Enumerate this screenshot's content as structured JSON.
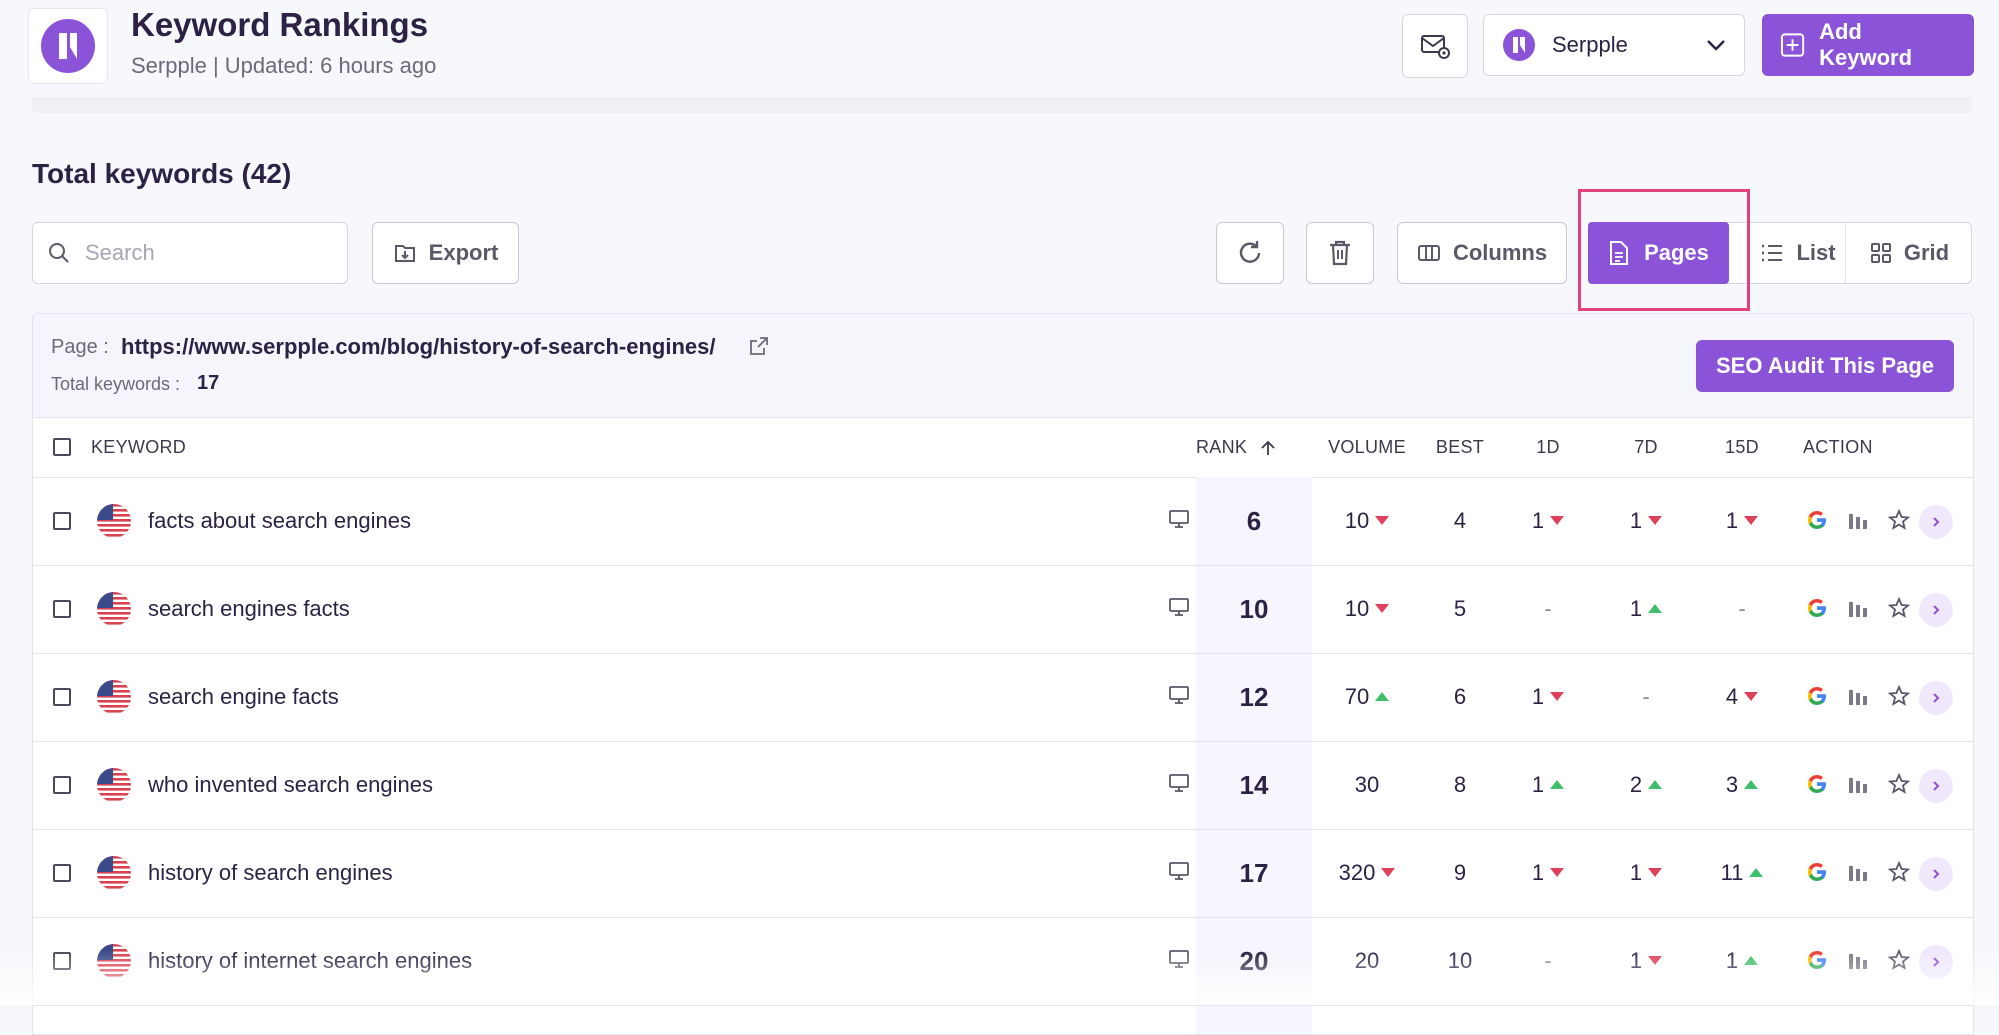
{
  "header": {
    "title": "Keyword Rankings",
    "subtitle": "Serpple | Updated: 6 hours ago",
    "project_select": "Serpple",
    "add_keyword_label": "Add Keyword"
  },
  "toolbar": {
    "total_keywords": "Total keywords (42)",
    "search_placeholder": "Search",
    "export_label": "Export",
    "columns_label": "Columns",
    "views": {
      "pages": "Pages",
      "list": "List",
      "grid": "Grid"
    },
    "active_view": "Pages"
  },
  "page_card": {
    "page_label": "Page :",
    "page_url": "https://www.serpple.com/blog/history-of-search-engines/",
    "total_label": "Total keywords :",
    "total_value": "17",
    "audit_label": "SEO Audit This Page"
  },
  "table": {
    "columns": {
      "keyword": "KEYWORD",
      "rank": "RANK",
      "volume": "VOLUME",
      "best": "BEST",
      "d1": "1D",
      "d7": "7D",
      "d15": "15D",
      "action": "ACTION"
    },
    "rows": [
      {
        "keyword": "facts about search engines",
        "rank": "6",
        "volume": "10",
        "volume_trend": "down",
        "best": "4",
        "d1": "1",
        "d1_trend": "down",
        "d7": "1",
        "d7_trend": "down",
        "d15": "1",
        "d15_trend": "down"
      },
      {
        "keyword": "search engines facts",
        "rank": "10",
        "volume": "10",
        "volume_trend": "down",
        "best": "5",
        "d1": "-",
        "d1_trend": "",
        "d7": "1",
        "d7_trend": "up",
        "d15": "-",
        "d15_trend": ""
      },
      {
        "keyword": "search engine facts",
        "rank": "12",
        "volume": "70",
        "volume_trend": "up",
        "best": "6",
        "d1": "1",
        "d1_trend": "down",
        "d7": "-",
        "d7_trend": "",
        "d15": "4",
        "d15_trend": "down"
      },
      {
        "keyword": "who invented search engines",
        "rank": "14",
        "volume": "30",
        "volume_trend": "",
        "best": "8",
        "d1": "1",
        "d1_trend": "up",
        "d7": "2",
        "d7_trend": "up",
        "d15": "3",
        "d15_trend": "up"
      },
      {
        "keyword": "history of search engines",
        "rank": "17",
        "volume": "320",
        "volume_trend": "down",
        "best": "9",
        "d1": "1",
        "d1_trend": "down",
        "d7": "1",
        "d7_trend": "down",
        "d15": "11",
        "d15_trend": "up"
      },
      {
        "keyword": "history of internet search engines",
        "rank": "20",
        "volume": "20",
        "volume_trend": "",
        "best": "10",
        "d1": "-",
        "d1_trend": "",
        "d7": "1",
        "d7_trend": "down",
        "d15": "1",
        "d15_trend": "up"
      }
    ]
  },
  "colors": {
    "accent": "#8b54d8",
    "trend_up": "#3fbf6a",
    "trend_down": "#e0405a",
    "highlight_box": "#e0437a"
  },
  "icons": [
    "logo-icon",
    "mail-settings-icon",
    "chevron-down-icon",
    "plus-square-icon",
    "search-icon",
    "export-icon",
    "refresh-icon",
    "trash-icon",
    "columns-icon",
    "page-icon",
    "list-icon",
    "grid-icon",
    "external-link-icon",
    "us-flag-icon",
    "desktop-icon",
    "google-icon",
    "bar-chart-icon",
    "star-icon",
    "chevron-right-icon"
  ]
}
